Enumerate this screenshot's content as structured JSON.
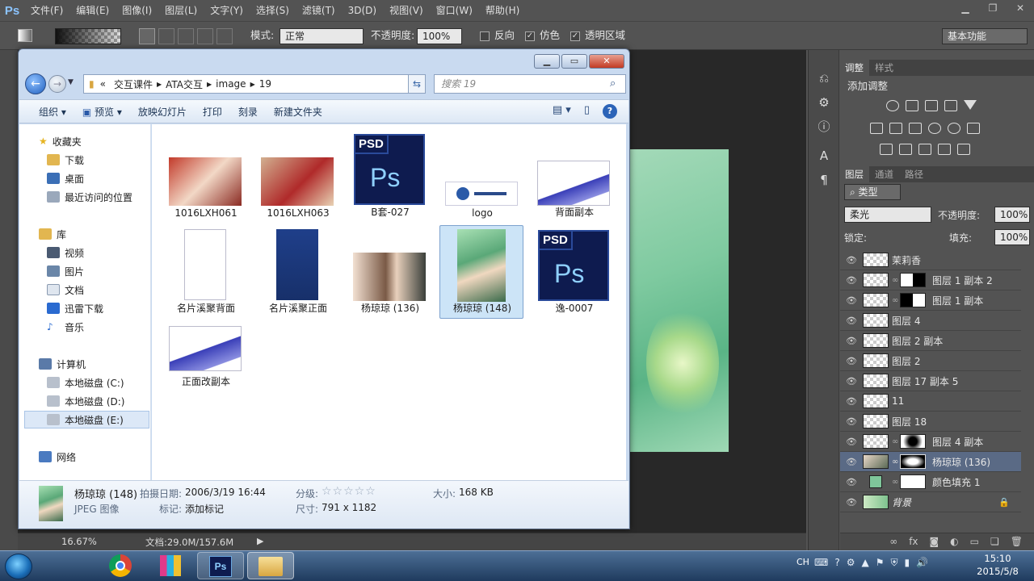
{
  "ps": {
    "logo": "Ps",
    "menus": [
      "文件(F)",
      "编辑(E)",
      "图像(I)",
      "图层(L)",
      "文字(Y)",
      "选择(S)",
      "滤镜(T)",
      "3D(D)",
      "视图(V)",
      "窗口(W)",
      "帮助(H)"
    ],
    "options": {
      "mode_label": "模式:",
      "mode_value": "正常",
      "opacity_label": "不透明度:",
      "opacity_value": "100%",
      "reverse": "反向",
      "dither": "仿色",
      "transparency": "透明区域",
      "workspace": "基本功能"
    },
    "status": {
      "zoom": "16.67%",
      "doc": "文档:29.0M/157.6M"
    },
    "adjust_tabs": [
      "调整",
      "样式"
    ],
    "add_adjust": "添加调整",
    "layers_tabs": [
      "图层",
      "通道",
      "路径"
    ],
    "layer_filter": "类型",
    "blend_mode": "柔光",
    "layer_opacity_label": "不透明度:",
    "layer_opacity": "100%",
    "lock_label": "锁定:",
    "fill_label": "填充:",
    "fill_value": "100%",
    "layers": [
      {
        "name": "茉莉香"
      },
      {
        "name": "图层 1 副本 2"
      },
      {
        "name": "图层 1 副本"
      },
      {
        "name": "图层 4"
      },
      {
        "name": "图层 2 副本"
      },
      {
        "name": "图层 2"
      },
      {
        "name": "图层 17 副本 5"
      },
      {
        "name": "11"
      },
      {
        "name": "图层 18"
      },
      {
        "name": "图层 4 副本"
      },
      {
        "name": "杨琼琼 (136)"
      },
      {
        "name": "颜色填充 1"
      },
      {
        "name": "背景"
      }
    ]
  },
  "explorer": {
    "path": [
      "«",
      "交互课件",
      "ATA交互",
      "image",
      "19"
    ],
    "search_placeholder": "搜索 19",
    "commands": [
      "组织 ▾",
      "预览 ▾",
      "放映幻灯片",
      "打印",
      "刻录",
      "新建文件夹"
    ],
    "nav": {
      "favorites": "收藏夹",
      "fav_items": [
        "下载",
        "桌面",
        "最近访问的位置"
      ],
      "libraries": "库",
      "lib_items": [
        "视频",
        "图片",
        "文档",
        "迅雷下载",
        "音乐"
      ],
      "computer": "计算机",
      "drives": [
        "本地磁盘 (C:)",
        "本地磁盘 (D:)",
        "本地磁盘 (E:)"
      ],
      "network": "网络"
    },
    "files": [
      {
        "name": "1016LXH061"
      },
      {
        "name": "1016LXH063"
      },
      {
        "name": "B套-027"
      },
      {
        "name": "logo"
      },
      {
        "name": "背面副本"
      },
      {
        "name": "名片溪聚背面"
      },
      {
        "name": "名片溪聚正面"
      },
      {
        "name": "杨琼琼 (136)"
      },
      {
        "name": "杨琼琼 (148)"
      },
      {
        "name": "逸-0007"
      },
      {
        "name": "正面改副本"
      }
    ],
    "psd_tag": "PSD",
    "details": {
      "name": "杨琼琼 (148)",
      "type": "JPEG 图像",
      "date_label": "拍摄日期:",
      "date": "2006/3/19 16:44",
      "tags_label": "标记:",
      "tags": "添加标记",
      "rating_label": "分级:",
      "rating": "☆☆☆☆☆",
      "dims_label": "尺寸:",
      "dims": "791 x 1182",
      "size_label": "大小:",
      "size": "168 KB"
    }
  },
  "taskbar": {
    "lang": "CH",
    "time": "15:10",
    "date": "2015/5/8"
  }
}
